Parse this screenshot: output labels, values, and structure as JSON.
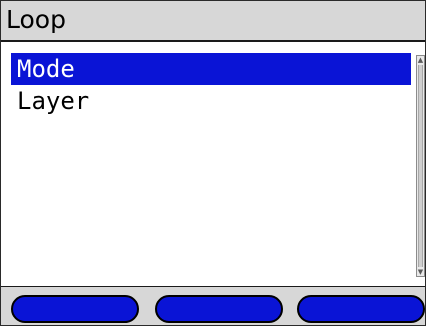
{
  "window": {
    "title": "Loop"
  },
  "menu": {
    "items": [
      {
        "label": "Mode",
        "selected": true
      },
      {
        "label": "Layer",
        "selected": false
      }
    ]
  },
  "scrollbar": {
    "up_icon": "triangle-up-icon",
    "down_icon": "triangle-down-icon"
  },
  "softkeys": {
    "left_label": "",
    "middle_label": "",
    "right_label": ""
  },
  "colors": {
    "selection": "#0a14d6",
    "softkey": "#0a14d6",
    "titlebar": "#d7d7d7"
  }
}
